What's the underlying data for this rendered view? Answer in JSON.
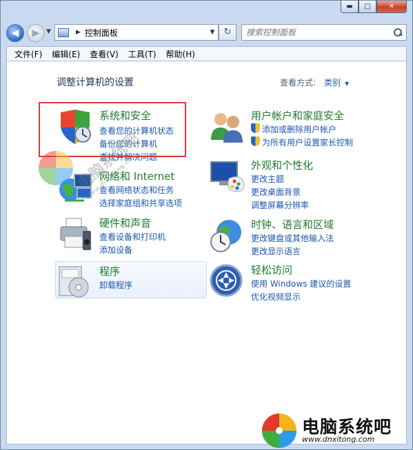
{
  "window": {
    "controls": {
      "minimize": "▬",
      "maximize": "□",
      "close": "✕"
    }
  },
  "nav": {
    "back": "◀",
    "forward": "▶",
    "recent": "▼",
    "address": {
      "separator": "▶",
      "location": "控制面板",
      "dropdown": "▼"
    },
    "refresh": "↻",
    "search_placeholder": "搜索控制面板"
  },
  "menu": [
    "文件(F)",
    "编辑(E)",
    "查看(V)",
    "工具(T)",
    "帮助(H)"
  ],
  "main": {
    "title": "调整计算机的设置",
    "view_by_label": "查看方式:",
    "view_by_value": "类别",
    "view_by_arrow": "▼"
  },
  "categories": {
    "system": {
      "title": "系统和安全",
      "links": [
        "查看您的计算机状态",
        "备份您的计算机",
        "查找并解决问题"
      ]
    },
    "network": {
      "title": "网络和 Internet",
      "links": [
        "查看网络状态和任务",
        "选择家庭组和共享选项"
      ]
    },
    "hardware": {
      "title": "硬件和声音",
      "links": [
        "查看设备和打印机",
        "添加设备"
      ]
    },
    "programs": {
      "title": "程序",
      "links": [
        "卸载程序"
      ]
    },
    "users": {
      "title": "用户帐户和家庭安全",
      "links": [
        "添加或删除用户帐户",
        "为所有用户设置家长控制"
      ]
    },
    "appearance": {
      "title": "外观和个性化",
      "links": [
        "更改主题",
        "更改桌面背景",
        "调整屏幕分辨率"
      ]
    },
    "clock": {
      "title": "时钟、语言和区域",
      "links": [
        "更改键盘或其他输入法",
        "更改显示语言"
      ]
    },
    "ease": {
      "title": "轻松访问",
      "links": [
        "使用 Windows 建议的设置",
        "优化视频显示"
      ]
    }
  },
  "watermark": {
    "text": "电脑系统吧",
    "url": "www.dnxitong.com"
  },
  "brand": {
    "name": "电脑系统吧",
    "url": "www.dnxitong.com"
  },
  "colors": {
    "category_title": "#1e7a2e",
    "link": "#1a56b0",
    "highlight_box": "#d63a3a"
  }
}
